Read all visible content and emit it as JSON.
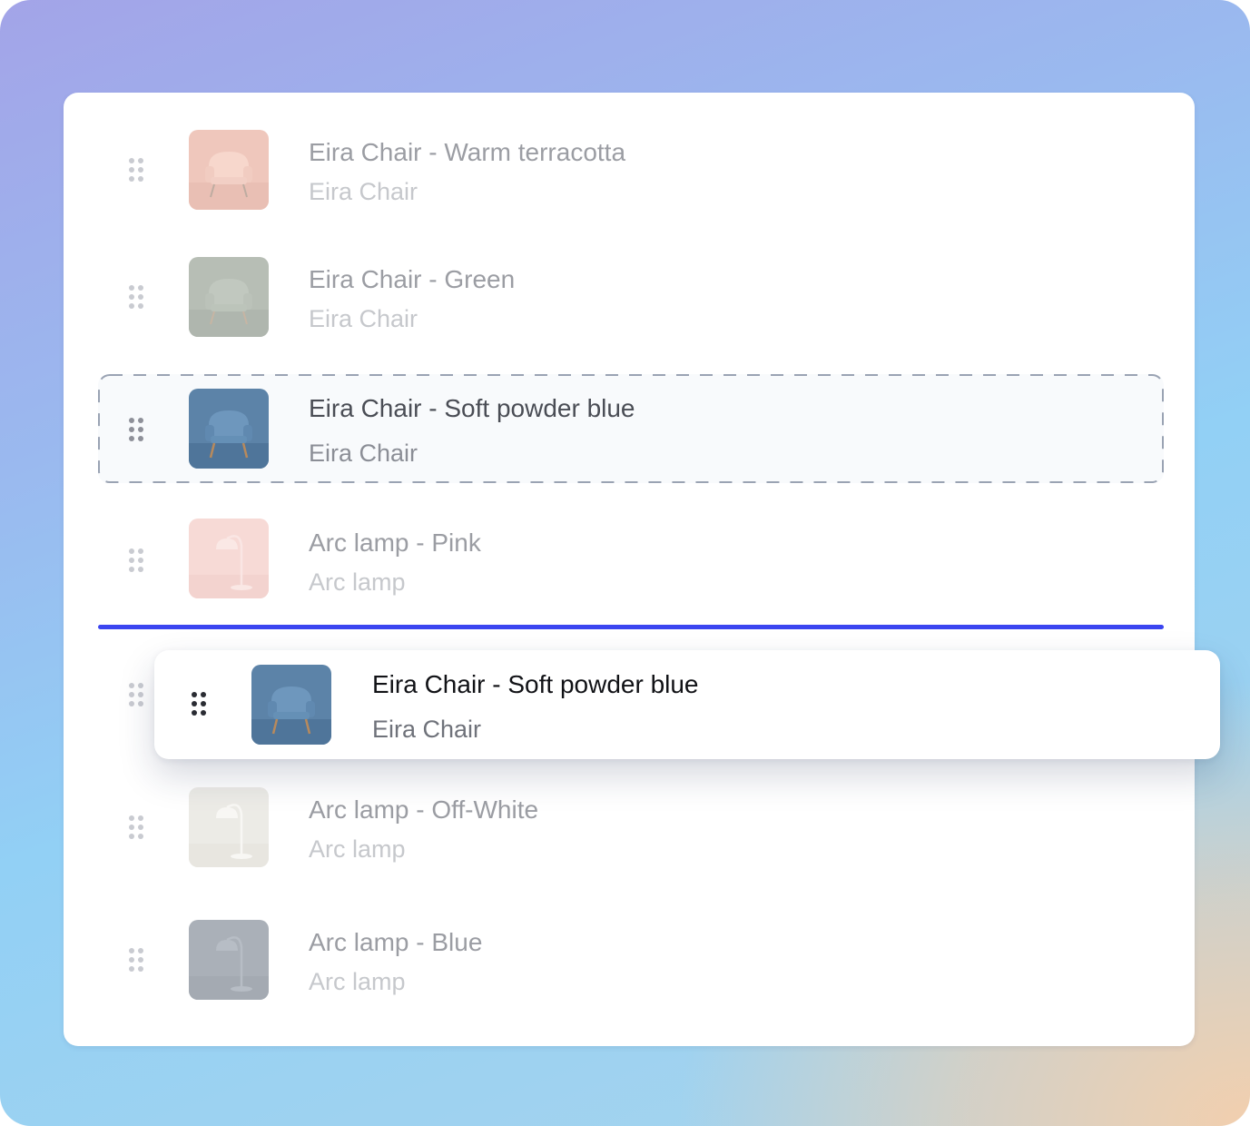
{
  "list": {
    "items": [
      {
        "title": "Eira Chair - Warm terracotta",
        "subtitle": "Eira Chair",
        "icon": "chair-thumbnail",
        "color": "#e4a58f"
      },
      {
        "title": "Eira Chair - Green",
        "subtitle": "Eira Chair",
        "icon": "chair-thumbnail",
        "color": "#8e9a8a"
      },
      {
        "title": "Eira Chair - Soft powder blue",
        "subtitle": "Eira Chair",
        "icon": "chair-thumbnail",
        "color": "#5f87ad",
        "state": "drop-placeholder"
      },
      {
        "title": "Arc lamp - Pink",
        "subtitle": "Arc lamp",
        "icon": "lamp-thumbnail",
        "color": "#f3c9c4"
      },
      {
        "title": "Arc lamp - Off-White",
        "subtitle": "Arc lamp",
        "icon": "lamp-thumbnail",
        "color": "#e8e6e0"
      },
      {
        "title": "Arc lamp - Blue",
        "subtitle": "Arc lamp",
        "icon": "lamp-thumbnail",
        "color": "#7b8694"
      }
    ],
    "dragging": {
      "title": "Eira Chair - Soft powder blue",
      "subtitle": "Eira Chair",
      "icon": "chair-thumbnail",
      "color": "#5f87ad"
    }
  },
  "colors": {
    "drop_indicator": "#3b45f0",
    "background_start": "#a3a4e8",
    "background_end": "#f2cfae"
  }
}
